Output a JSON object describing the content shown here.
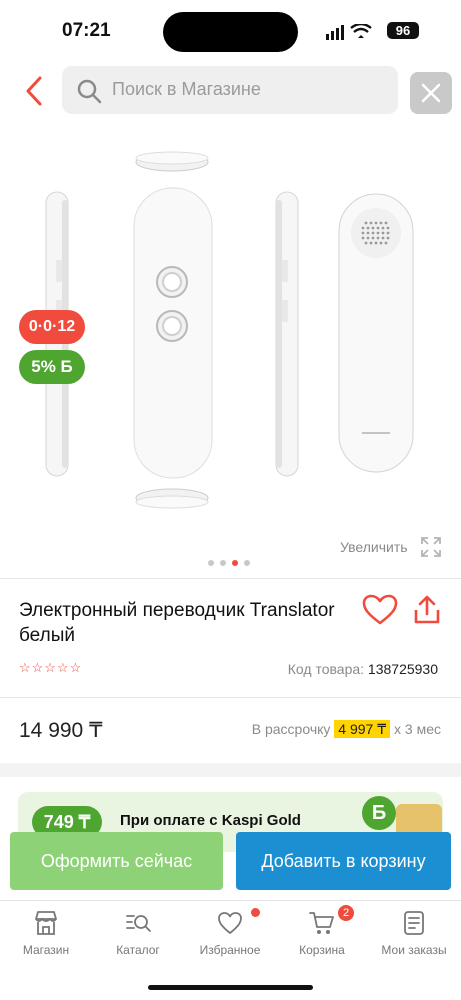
{
  "status": {
    "time": "07:21",
    "battery": "96"
  },
  "search": {
    "placeholder": "Поиск в Магазине"
  },
  "badges": {
    "discount": "0·0·12",
    "bonus": "5% Б"
  },
  "gallery": {
    "zoom_label": "Увеличить",
    "page_count": 4,
    "active_index": 2
  },
  "product": {
    "title": "Электронный переводчик Translator белый",
    "rating_stars": "☆☆☆☆☆",
    "code_label": "Код товара:",
    "code_value": "138725930",
    "price": "14 990 ₸",
    "installment_label": "В рассрочку",
    "installment_amount": "4 997 ₸",
    "installment_term": "х 3 мес"
  },
  "promo": {
    "amount": "749 ₸",
    "text": "При оплате с Kaspi Gold",
    "coin": "Б"
  },
  "actions": {
    "checkout": "Оформить сейчас",
    "add_to_cart": "Добавить в корзину"
  },
  "tabs": [
    {
      "label": "Магазин",
      "icon": "store-icon"
    },
    {
      "label": "Каталог",
      "icon": "catalog-search-icon"
    },
    {
      "label": "Избранное",
      "icon": "heart-icon"
    },
    {
      "label": "Корзина",
      "icon": "cart-icon",
      "badge": "2"
    },
    {
      "label": "Мои заказы",
      "icon": "orders-icon"
    }
  ],
  "colors": {
    "accent_red": "#f04b3c",
    "bonus_green": "#4ea631",
    "cart_blue": "#1b8fd1",
    "checkout_green": "#8ed277",
    "installment_yellow": "#ffd400"
  }
}
